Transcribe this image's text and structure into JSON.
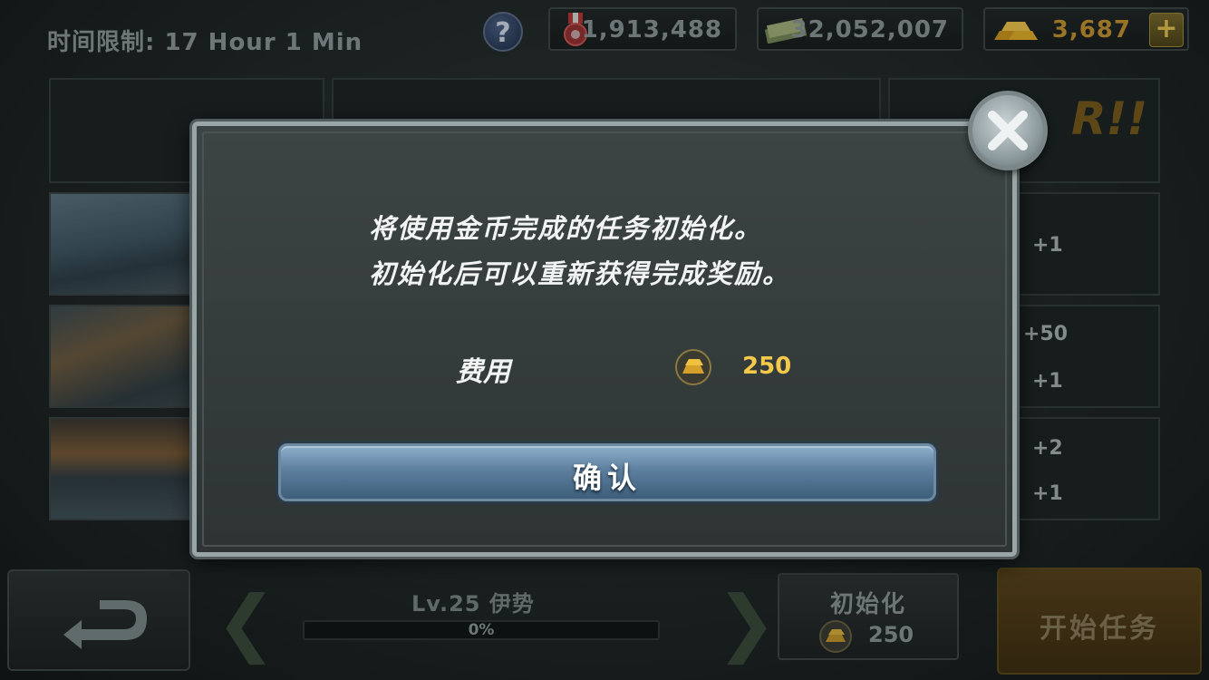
{
  "header": {
    "timer": "时间限制: 17 Hour 1 Min",
    "help_label": "?",
    "medals": "1,913,488",
    "cash": "32,052,007",
    "gold": "3,687",
    "plus_label": "+"
  },
  "background": {
    "reward_rows": [
      {
        "a": "+1"
      },
      {
        "a": "+50",
        "b": "+1"
      },
      {
        "a": "+2",
        "b": "+1"
      }
    ],
    "warning_text": "R!!"
  },
  "bottom": {
    "ship_name": "Lv.25 伊势",
    "progress_text": "0%",
    "progress_fraction": 0,
    "reset_label": "初始化",
    "reset_cost": "250",
    "start_label": "开始任务"
  },
  "dialog": {
    "message_line1": "将使用金币完成的任务初始化。",
    "message_line2": "初始化后可以重新获得完成奖励。",
    "cost_label": "费用",
    "cost_value": "250",
    "confirm_label": "确认"
  },
  "colors": {
    "gold_text": "#f4c84a",
    "confirm_blue": "#5d7f9e"
  }
}
